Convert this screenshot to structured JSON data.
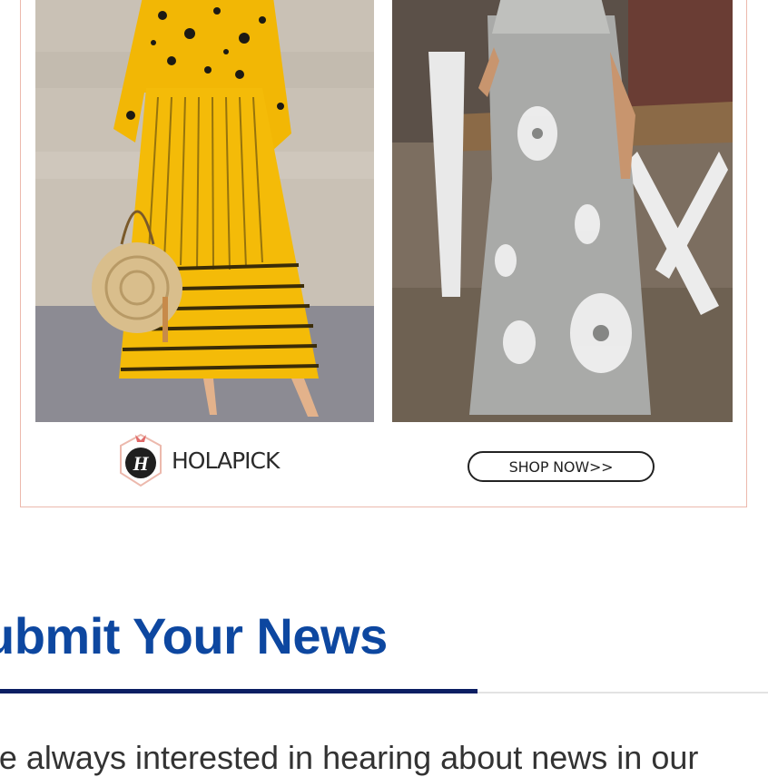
{
  "ad": {
    "brand_name": "HOLAPICK",
    "brand_logo_letter": "H",
    "shop_button_label": "SHOP NOW>>"
  },
  "section": {
    "title": "ubmit Your News",
    "intro": "e're always interested in hearing about news in our"
  },
  "colors": {
    "title_blue": "#0d47a0",
    "rule_accent": "#0b1e63",
    "ad_border": "#ecb9ad"
  }
}
